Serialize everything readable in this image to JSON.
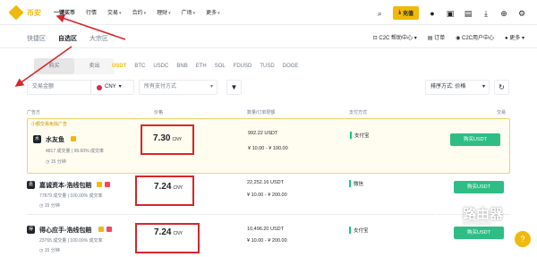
{
  "topnav": {
    "logo_text": "币安",
    "items": [
      {
        "label": "一键买币"
      },
      {
        "label": "行情"
      },
      {
        "label": "交易"
      },
      {
        "label": "合约"
      },
      {
        "label": "理财"
      },
      {
        "label": "广场"
      },
      {
        "label": "更多"
      }
    ],
    "deposit_label": "充值",
    "brand_color": "#f0b90b"
  },
  "subnav": {
    "tabs": [
      {
        "label": "快捷区"
      },
      {
        "label": "自选区"
      },
      {
        "label": "大宗区"
      }
    ],
    "active_tab": "自选区",
    "right": [
      {
        "label": "C2C 帮助中心"
      },
      {
        "label": "订单"
      },
      {
        "label": "C2C用户中心"
      },
      {
        "label": "更多"
      }
    ]
  },
  "trade": {
    "buy_label": "购买",
    "sell_label": "卖出",
    "assets": [
      "USDT",
      "BTC",
      "USDC",
      "BNB",
      "ETH",
      "SOL",
      "FDUSD",
      "TUSD",
      "DOGE"
    ],
    "active_asset": "USDT"
  },
  "filters": {
    "amount_placeholder": "交易金额",
    "currency": "CNY",
    "payment": "所有支付方式",
    "sort": "排序方式: 价格"
  },
  "table": {
    "headers": {
      "advertiser": "广告方",
      "price": "价格",
      "qty": "数量/订单限额",
      "pay": "支付方式",
      "action": "交易"
    },
    "promo_tag": "小额交易免除广告",
    "rows": [
      {
        "avatar": "水",
        "name": "水友鱼",
        "orders": "4817 成交量",
        "rate": "99.60% 成交率",
        "time": "15 分钟",
        "price": "7.30",
        "unit": "CNY",
        "qty": "992.22 USDT",
        "limit": "¥ 10.00 - ¥ 100.00",
        "pay": "支付宝",
        "btn": "购买USDT"
      },
      {
        "avatar": "嘉",
        "name": "嘉诚资本-浩线包赔",
        "orders": "77879 成交量",
        "rate": "100.00% 成交率",
        "time": "15 分钟",
        "price": "7.24",
        "unit": "CNY",
        "qty": "22,252.16 USDT",
        "limit": "¥ 10.00 - ¥ 200.00",
        "pay": "微信",
        "btn": "购买USDT"
      },
      {
        "avatar": "得",
        "name": "得心应手-浩线包赔",
        "orders": "23765 成交量",
        "rate": "100.00% 成交率",
        "time": "15 分钟",
        "price": "7.24",
        "unit": "CNY",
        "qty": "10,496.20 USDT",
        "limit": "¥ 10.00 - ¥ 200.00",
        "pay": "支付宝",
        "btn": "购买USDT"
      }
    ]
  },
  "watermark": {
    "text": "路由器",
    "sub": "www.luyouqi.com"
  }
}
